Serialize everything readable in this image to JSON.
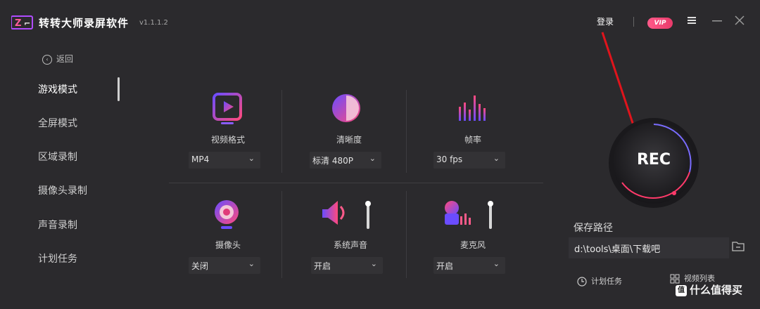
{
  "app": {
    "logo": "Z",
    "title": "转转大师录屏软件",
    "version": "v1.1.1.2"
  },
  "header": {
    "login": "登录",
    "vip": "VIP"
  },
  "sidebar": {
    "back": "返回",
    "items": [
      {
        "label": "游戏模式",
        "active": true
      },
      {
        "label": "全屏模式"
      },
      {
        "label": "区域录制"
      },
      {
        "label": "摄像头录制"
      },
      {
        "label": "声音录制"
      },
      {
        "label": "计划任务"
      }
    ]
  },
  "settings": {
    "video_format": {
      "label": "视频格式",
      "value": "MP4",
      "icon": "play-icon"
    },
    "clarity": {
      "label": "清晰度",
      "value": "标清 480P",
      "icon": "clarity-icon"
    },
    "frame_rate": {
      "label": "帧率",
      "value": "30 fps",
      "icon": "bars-icon"
    },
    "camera": {
      "label": "摄像头",
      "value": "关闭",
      "icon": "camera-icon"
    },
    "system_sound": {
      "label": "系统声音",
      "value": "开启",
      "icon": "speaker-icon"
    },
    "microphone": {
      "label": "麦克风",
      "value": "开启",
      "icon": "mic-icon"
    }
  },
  "record": {
    "label": "REC"
  },
  "save": {
    "title": "保存路径",
    "path": "d:\\tools\\桌面\\下载吧"
  },
  "footer": {
    "schedule": "计划任务",
    "video_list": "视频列表"
  },
  "watermark": {
    "text": "什么值得买",
    "badge": "值"
  },
  "colors": {
    "accent": "#e8336b",
    "gradient_start": "#6a4cff",
    "gradient_end": "#ff4a7d",
    "arrow": "#e0141c"
  }
}
